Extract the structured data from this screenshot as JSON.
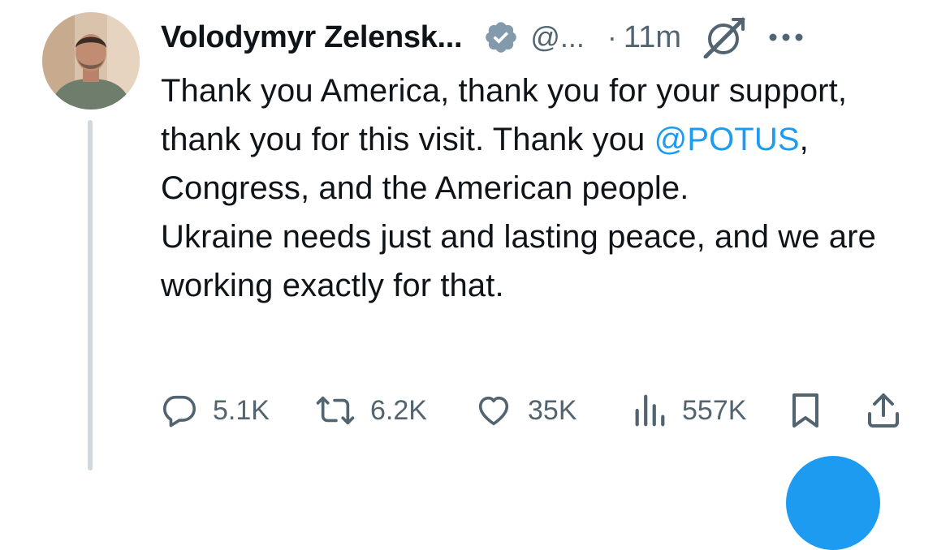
{
  "tweet": {
    "author_name": "Volodymyr Zelensk...",
    "handle": "@...",
    "separator": "·",
    "time_ago": "11m",
    "text_para1_before": "Thank you America, thank you for your support, thank you for this visit. Thank you ",
    "mention": "@POTUS",
    "text_para1_after": ", Congress, and the American people.",
    "text_para2": "Ukraine needs just and lasting peace, and we are working exactly for that."
  },
  "actions": {
    "replies": "5.1K",
    "reposts": "6.2K",
    "likes": "35K",
    "views": "557K"
  },
  "icons": {
    "verified": "verified-badge-icon",
    "grok": "grok-icon",
    "more": "more-icon",
    "reply": "reply-icon",
    "repost": "repost-icon",
    "like": "heart-icon",
    "views": "views-icon",
    "bookmark": "bookmark-icon",
    "share": "share-icon"
  },
  "colors": {
    "link": "#1d9bf0",
    "secondary_text": "#536471",
    "primary_text": "#0f1419",
    "thread_line": "#cfd9de"
  }
}
